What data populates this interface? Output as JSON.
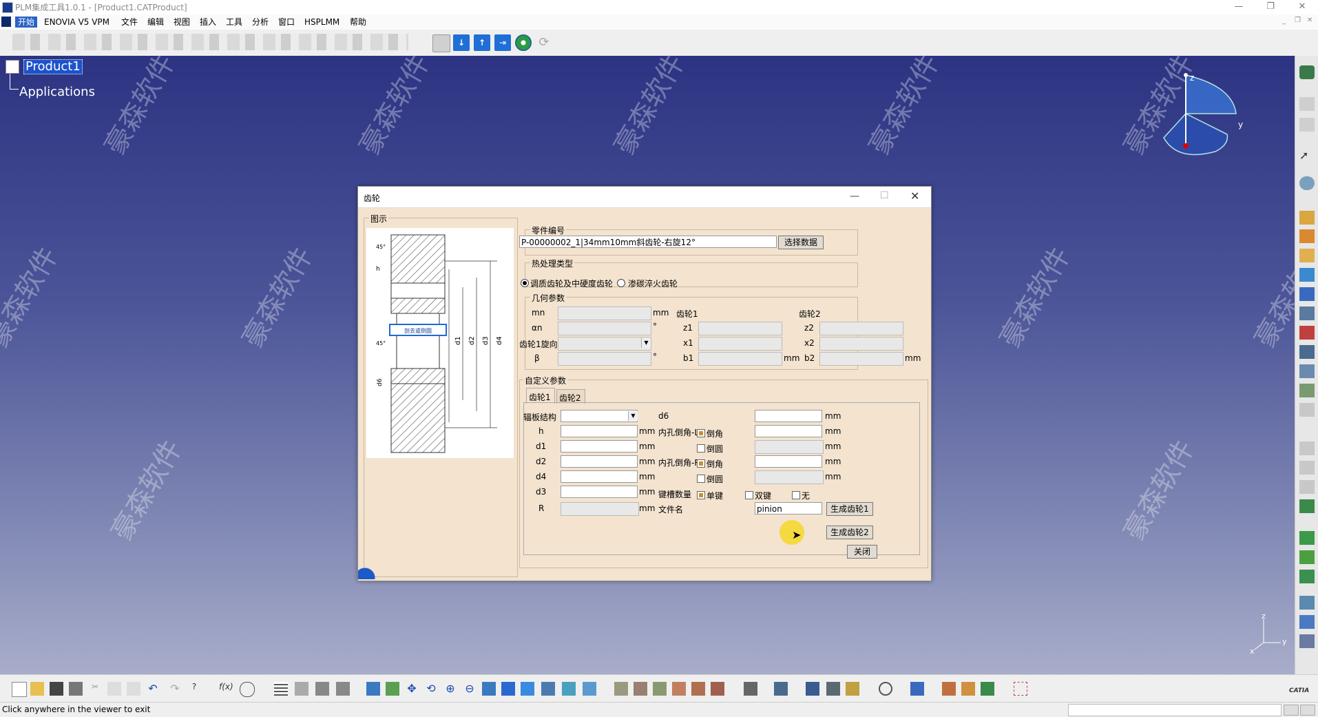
{
  "window": {
    "title": "PLM集成工具1.0.1 - [Product1.CATProduct]"
  },
  "menu": {
    "items": [
      "开始",
      "ENOVIA V5 VPM",
      "文件",
      "编辑",
      "视图",
      "插入",
      "工具",
      "分析",
      "窗口",
      "HSPLMM",
      "帮助"
    ],
    "active_index": 0
  },
  "tree": {
    "root": "Product1",
    "child": "Applications"
  },
  "watermark": "豪森软件",
  "compass": {
    "x_label": "x",
    "y_label": "y",
    "z_label": "z"
  },
  "dialog": {
    "title": "齿轮",
    "diagram_section": "图示",
    "diagram_text": {
      "side_text": "剖去或倒圆",
      "angle1": "45°",
      "angle2": "45°",
      "h": "h",
      "d1": "d1",
      "d2": "d2",
      "d3": "d3",
      "d4": "d4",
      "d6": "d6"
    },
    "part_no": {
      "legend": "零件编号",
      "value": "P-00000002_1|34mm10mm斜齿轮-右旋12°",
      "select_button": "选择数据"
    },
    "heat_treatment": {
      "legend": "热处理类型",
      "options": [
        "调质齿轮及中硬度齿轮",
        "渗碳淬火齿轮"
      ],
      "selected": 0
    },
    "geometry": {
      "legend": "几何参数",
      "gear1_header": "齿轮1",
      "gear2_header": "齿轮2",
      "mn_label": "mn",
      "alpha_label": "αn",
      "rotation_label": "齿轮1旋向",
      "beta_label": "β",
      "z1_label": "z1",
      "x1_label": "x1",
      "b1_label": "b1",
      "z2_label": "z2",
      "x2_label": "x2",
      "b2_label": "b2",
      "unit_mm": "mm",
      "unit_deg": "°"
    },
    "custom": {
      "legend": "自定义参数",
      "tabs": [
        "齿轮1",
        "齿轮2"
      ],
      "active_tab": 0,
      "web_label": "辐板结构",
      "h_label": "h",
      "d1_label": "d1",
      "d2_label": "d2",
      "d4_label": "d4",
      "d3_label": "d3",
      "r_label": "R",
      "d6_label": "d6",
      "inner_l_label": "内孔倒角-L",
      "inner_r_label": "内孔倒角-R",
      "keyway_label": "键槽数量",
      "filename_label": "文件名",
      "chamfer": "倒角",
      "round": "倒圆",
      "single_key": "单键",
      "double_key": "双键",
      "no_key": "无",
      "unit_mm": "mm",
      "filename_value": "pinion",
      "gen1_button": "生成齿轮1",
      "gen2_button": "生成齿轮2",
      "close_button": "关闭"
    }
  },
  "status": {
    "text": "Click anywhere in the viewer to exit"
  },
  "logo": "CATIA"
}
